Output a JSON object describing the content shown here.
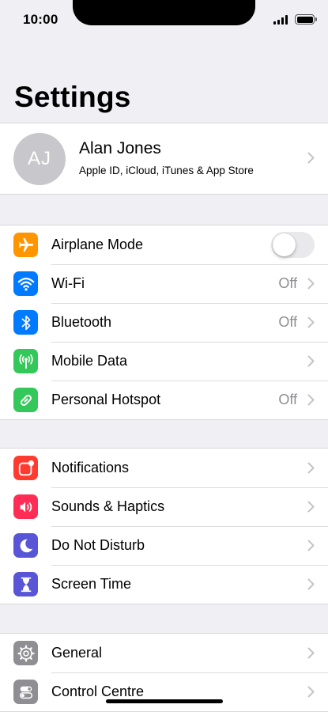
{
  "status_bar": {
    "time": "10:00"
  },
  "page": {
    "title": "Settings"
  },
  "profile": {
    "initials": "AJ",
    "name": "Alan Jones",
    "subtitle": "Apple ID, iCloud, iTunes & App Store"
  },
  "groups": {
    "connectivity": [
      {
        "label": "Airplane Mode",
        "icon": "airplane-icon",
        "color": "#ff9500",
        "toggle_on": false
      },
      {
        "label": "Wi-Fi",
        "icon": "wifi-icon",
        "color": "#007aff",
        "value": "Off"
      },
      {
        "label": "Bluetooth",
        "icon": "bluetooth-icon",
        "color": "#007aff",
        "value": "Off"
      },
      {
        "label": "Mobile Data",
        "icon": "antenna-icon",
        "color": "#34c759"
      },
      {
        "label": "Personal Hotspot",
        "icon": "hotspot-icon",
        "color": "#34c759",
        "value": "Off"
      }
    ],
    "alerts": [
      {
        "label": "Notifications",
        "icon": "notifications-icon",
        "color": "#ff3b30"
      },
      {
        "label": "Sounds & Haptics",
        "icon": "speaker-icon",
        "color": "#ff2d55"
      },
      {
        "label": "Do Not Disturb",
        "icon": "moon-icon",
        "color": "#5856d6"
      },
      {
        "label": "Screen Time",
        "icon": "hourglass-icon",
        "color": "#5856d6"
      }
    ],
    "system": [
      {
        "label": "General",
        "icon": "gear-icon",
        "color": "#8e8e93"
      },
      {
        "label": "Control Centre",
        "icon": "toggles-icon",
        "color": "#8e8e93"
      }
    ]
  }
}
